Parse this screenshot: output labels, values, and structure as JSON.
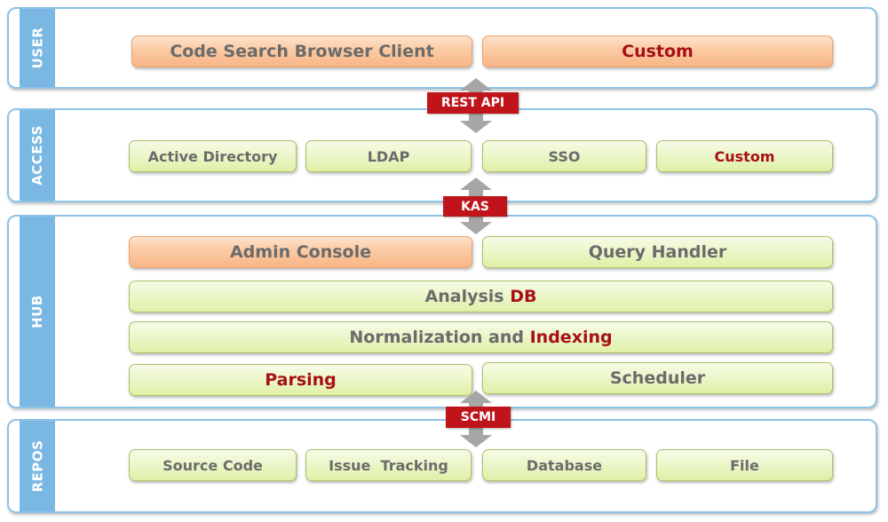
{
  "layers": {
    "user": {
      "label": "USER",
      "boxes": [
        {
          "text": "Code Search Browser Client"
        },
        {
          "text": "Custom"
        }
      ]
    },
    "access": {
      "label": "ACCESS",
      "boxes": [
        {
          "text": "Active Directory"
        },
        {
          "text": "LDAP"
        },
        {
          "text": "SSO"
        },
        {
          "text": "Custom"
        }
      ]
    },
    "hub": {
      "label": "HUB",
      "admin_console": "Admin Console",
      "query_handler": "Query Handler",
      "analysis_db": {
        "prefix": "Analysis ",
        "highlight": "DB"
      },
      "normalization": {
        "prefix": "Normalization and ",
        "highlight": "Indexing"
      },
      "parsing": "Parsing",
      "scheduler": "Scheduler"
    },
    "repos": {
      "label": "REPOS",
      "boxes": [
        {
          "text": "Source Code"
        },
        {
          "text": "Issue  Tracking"
        },
        {
          "text": "Database"
        },
        {
          "text": "File"
        }
      ]
    }
  },
  "connectors": {
    "user_access": "REST API",
    "access_hub": "KAS",
    "hub_repos": "SCMI"
  },
  "colors": {
    "layer_border": "#8dc3e6",
    "layer_label_bg": "#7ab8e3",
    "connector_red": "#c0141b",
    "highlight_text": "#a61016",
    "box_text": "#6b6b6b",
    "orange_box": "#fbcaa2",
    "green_box": "#ebf6c8",
    "arrow_gray": "#a6a6a6"
  }
}
